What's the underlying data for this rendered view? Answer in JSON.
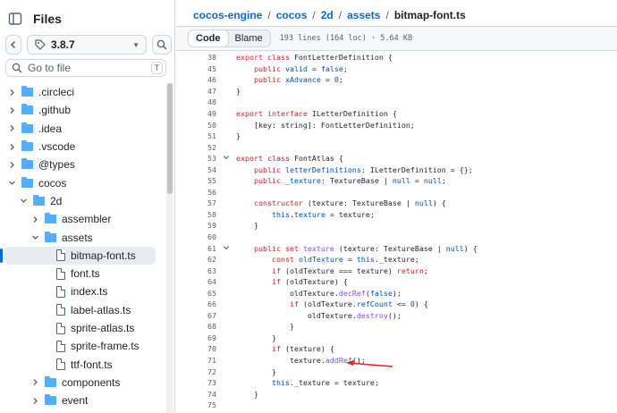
{
  "sidebar": {
    "title": "Files",
    "branch": "3.8.7",
    "goto_placeholder": "Go to file",
    "goto_shortcut": "T",
    "tree": [
      {
        "label": ".circleci",
        "type": "folder",
        "depth": 0,
        "expanded": false
      },
      {
        "label": ".github",
        "type": "folder",
        "depth": 0,
        "expanded": false
      },
      {
        "label": ".idea",
        "type": "folder",
        "depth": 0,
        "expanded": false
      },
      {
        "label": ".vscode",
        "type": "folder",
        "depth": 0,
        "expanded": false
      },
      {
        "label": "@types",
        "type": "folder",
        "depth": 0,
        "expanded": false
      },
      {
        "label": "cocos",
        "type": "folder",
        "depth": 0,
        "expanded": true
      },
      {
        "label": "2d",
        "type": "folder",
        "depth": 1,
        "expanded": true
      },
      {
        "label": "assembler",
        "type": "folder",
        "depth": 2,
        "expanded": false
      },
      {
        "label": "assets",
        "type": "folder",
        "depth": 2,
        "expanded": true
      },
      {
        "label": "bitmap-font.ts",
        "type": "file",
        "depth": 3,
        "selected": true
      },
      {
        "label": "font.ts",
        "type": "file",
        "depth": 3
      },
      {
        "label": "index.ts",
        "type": "file",
        "depth": 3
      },
      {
        "label": "label-atlas.ts",
        "type": "file",
        "depth": 3
      },
      {
        "label": "sprite-atlas.ts",
        "type": "file",
        "depth": 3
      },
      {
        "label": "sprite-frame.ts",
        "type": "file",
        "depth": 3
      },
      {
        "label": "ttf-font.ts",
        "type": "file",
        "depth": 3
      },
      {
        "label": "components",
        "type": "folder",
        "depth": 2,
        "expanded": false
      },
      {
        "label": "event",
        "type": "folder",
        "depth": 2,
        "expanded": false
      }
    ]
  },
  "breadcrumb": {
    "items": [
      "cocos-engine",
      "cocos",
      "2d",
      "assets"
    ],
    "current": "bitmap-font.ts",
    "separator": "/"
  },
  "toolbar": {
    "code_label": "Code",
    "blame_label": "Blame",
    "file_info": "193 lines (164 loc) · 5.64 KB"
  },
  "code_lines": [
    {
      "n": "38",
      "fold": "",
      "tokens": [
        {
          "t": "export class ",
          "c": "kw"
        },
        {
          "t": "FontLetterDefinition {",
          "c": ""
        }
      ]
    },
    {
      "n": "45",
      "fold": "",
      "tokens": [
        {
          "t": "    "
        },
        {
          "t": "public ",
          "c": "kw"
        },
        {
          "t": "valid",
          "c": "cn"
        },
        {
          "t": " = "
        },
        {
          "t": "false",
          "c": "cn"
        },
        {
          "t": ";"
        }
      ]
    },
    {
      "n": "46",
      "fold": "",
      "tokens": [
        {
          "t": "    "
        },
        {
          "t": "public ",
          "c": "kw"
        },
        {
          "t": "xAdvance",
          "c": "cn"
        },
        {
          "t": " = "
        },
        {
          "t": "0",
          "c": "cn"
        },
        {
          "t": ";"
        }
      ]
    },
    {
      "n": "47",
      "fold": "",
      "tokens": [
        {
          "t": "}"
        }
      ]
    },
    {
      "n": "48",
      "fold": "",
      "tokens": [
        {
          "t": ""
        }
      ]
    },
    {
      "n": "49",
      "fold": "",
      "tokens": [
        {
          "t": "export interface ",
          "c": "kw"
        },
        {
          "t": "ILetterDefinition {"
        }
      ]
    },
    {
      "n": "50",
      "fold": "",
      "tokens": [
        {
          "t": "    [key: string]: FontLetterDefinition;"
        }
      ]
    },
    {
      "n": "51",
      "fold": "",
      "tokens": [
        {
          "t": "}"
        }
      ]
    },
    {
      "n": "52",
      "fold": "",
      "tokens": [
        {
          "t": ""
        }
      ]
    },
    {
      "n": "53",
      "fold": "v",
      "tokens": [
        {
          "t": "export class ",
          "c": "kw"
        },
        {
          "t": "FontAtlas {"
        }
      ]
    },
    {
      "n": "54",
      "fold": "",
      "tokens": [
        {
          "t": "    "
        },
        {
          "t": "public ",
          "c": "kw"
        },
        {
          "t": "letterDefinitions",
          "c": "cn"
        },
        {
          "t": ": ILetterDefinition = {};"
        }
      ]
    },
    {
      "n": "55",
      "fold": "",
      "tokens": [
        {
          "t": "    "
        },
        {
          "t": "public ",
          "c": "kw"
        },
        {
          "t": "_texture",
          "c": "cn"
        },
        {
          "t": ": TextureBase | "
        },
        {
          "t": "null",
          "c": "cn"
        },
        {
          "t": " = "
        },
        {
          "t": "null",
          "c": "cn"
        },
        {
          "t": ";"
        }
      ]
    },
    {
      "n": "56",
      "fold": "",
      "tokens": [
        {
          "t": ""
        }
      ]
    },
    {
      "n": "57",
      "fold": "",
      "tokens": [
        {
          "t": "    "
        },
        {
          "t": "constructor",
          "c": "kw"
        },
        {
          "t": " (texture: TextureBase | "
        },
        {
          "t": "null",
          "c": "cn"
        },
        {
          "t": ") {"
        }
      ]
    },
    {
      "n": "58",
      "fold": "",
      "tokens": [
        {
          "t": "        "
        },
        {
          "t": "this",
          "c": "cn"
        },
        {
          "t": "."
        },
        {
          "t": "texture",
          "c": "cn"
        },
        {
          "t": " = texture;"
        }
      ]
    },
    {
      "n": "59",
      "fold": "",
      "tokens": [
        {
          "t": "    }"
        }
      ]
    },
    {
      "n": "60",
      "fold": "",
      "tokens": [
        {
          "t": ""
        }
      ]
    },
    {
      "n": "61",
      "fold": "v",
      "tokens": [
        {
          "t": "    "
        },
        {
          "t": "public set ",
          "c": "kw"
        },
        {
          "t": "texture",
          "c": "fn"
        },
        {
          "t": " (texture: TextureBase | "
        },
        {
          "t": "null",
          "c": "cn"
        },
        {
          "t": ") {"
        }
      ]
    },
    {
      "n": "62",
      "fold": "",
      "tokens": [
        {
          "t": "        "
        },
        {
          "t": "const ",
          "c": "kw"
        },
        {
          "t": "oldTexture",
          "c": "cn"
        },
        {
          "t": " = "
        },
        {
          "t": "this",
          "c": "cn"
        },
        {
          "t": "._texture;"
        }
      ]
    },
    {
      "n": "63",
      "fold": "",
      "tokens": [
        {
          "t": "        "
        },
        {
          "t": "if ",
          "c": "kw"
        },
        {
          "t": "(oldTexture === texture) "
        },
        {
          "t": "return",
          "c": "kw"
        },
        {
          "t": ";"
        }
      ]
    },
    {
      "n": "64",
      "fold": "",
      "tokens": [
        {
          "t": "        "
        },
        {
          "t": "if ",
          "c": "kw"
        },
        {
          "t": "(oldTexture) {"
        }
      ]
    },
    {
      "n": "65",
      "fold": "",
      "tokens": [
        {
          "t": "            oldTexture."
        },
        {
          "t": "decRef",
          "c": "fn"
        },
        {
          "t": "("
        },
        {
          "t": "false",
          "c": "cn"
        },
        {
          "t": ");"
        }
      ]
    },
    {
      "n": "66",
      "fold": "",
      "tokens": [
        {
          "t": "            "
        },
        {
          "t": "if ",
          "c": "kw"
        },
        {
          "t": "(oldTexture."
        },
        {
          "t": "refCount",
          "c": "cn"
        },
        {
          "t": " <= "
        },
        {
          "t": "0",
          "c": "cn"
        },
        {
          "t": ") {"
        }
      ]
    },
    {
      "n": "67",
      "fold": "",
      "tokens": [
        {
          "t": "                oldTexture."
        },
        {
          "t": "destroy",
          "c": "fn"
        },
        {
          "t": "();"
        }
      ]
    },
    {
      "n": "68",
      "fold": "",
      "tokens": [
        {
          "t": "            }"
        }
      ]
    },
    {
      "n": "69",
      "fold": "",
      "tokens": [
        {
          "t": "        }"
        }
      ]
    },
    {
      "n": "70",
      "fold": "",
      "tokens": [
        {
          "t": "        "
        },
        {
          "t": "if ",
          "c": "kw"
        },
        {
          "t": "(texture) {"
        }
      ]
    },
    {
      "n": "71",
      "fold": "",
      "tokens": [
        {
          "t": "            texture."
        },
        {
          "t": "addRef",
          "c": "fn"
        },
        {
          "t": "();"
        }
      ]
    },
    {
      "n": "72",
      "fold": "",
      "tokens": [
        {
          "t": "        }"
        }
      ]
    },
    {
      "n": "73",
      "fold": "",
      "tokens": [
        {
          "t": "        "
        },
        {
          "t": "this",
          "c": "cn"
        },
        {
          "t": "._texture = texture;"
        }
      ]
    },
    {
      "n": "74",
      "fold": "",
      "tokens": [
        {
          "t": "    }"
        }
      ]
    },
    {
      "n": "75",
      "fold": "",
      "tokens": [
        {
          "t": ""
        }
      ]
    }
  ],
  "colors": {
    "link": "#0969da",
    "keyword": "#cf222e",
    "function": "#8250df",
    "constant": "#0550ae",
    "annotation_arrow": "#e5202e",
    "folder": "#54aeff"
  },
  "icons": {
    "sidebar_toggle": "sidebar-panel-icon",
    "branch": "tag-icon",
    "search": "search-icon",
    "goto": "search-icon",
    "folder": "folder-icon",
    "file": "file-icon"
  }
}
